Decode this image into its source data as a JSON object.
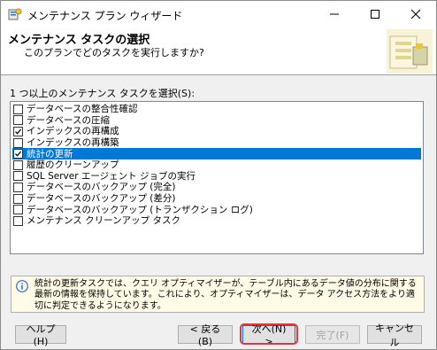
{
  "window": {
    "title": "メンテナンス プラン ウィザード"
  },
  "header": {
    "title": "メンテナンス タスクの選択",
    "subtitle": "このプランでどのタスクを実行しますか?"
  },
  "tasks": {
    "label": "1 つ以上のメンテナンス タスクを選択(S):",
    "items": [
      {
        "label": "データベースの整合性確認",
        "checked": false
      },
      {
        "label": "データベースの圧縮",
        "checked": false
      },
      {
        "label": "インデックスの再構成",
        "checked": true
      },
      {
        "label": "インデックスの再構築",
        "checked": false
      },
      {
        "label": "統計の更新",
        "checked": true,
        "selected": true
      },
      {
        "label": "履歴のクリーンアップ",
        "checked": false
      },
      {
        "label": "SQL Server エージェント ジョブの実行",
        "checked": false
      },
      {
        "label": "データベースのバックアップ (完全)",
        "checked": false
      },
      {
        "label": "データベースのバックアップ (差分)",
        "checked": false
      },
      {
        "label": "データベースのバックアップ (トランザクション ログ)",
        "checked": false
      },
      {
        "label": "メンテナンス クリーンアップ タスク",
        "checked": false
      }
    ]
  },
  "info": {
    "text": "統計の更新タスクでは、クエリ オプティマイザーが、テーブル内にあるデータ値の分布に関する最新の情報を保持しています。これにより、オプティマイザーは、データ アクセス方法をより適切に判定できるようになります。"
  },
  "buttons": {
    "help": "ヘルプ(H)",
    "back": "< 戻る(B)",
    "next": "次へ(N) >",
    "finish": "完了(F)",
    "cancel": "キャンセル"
  },
  "colors": {
    "selection": "#0078d7",
    "highlight": "#e8323c"
  }
}
